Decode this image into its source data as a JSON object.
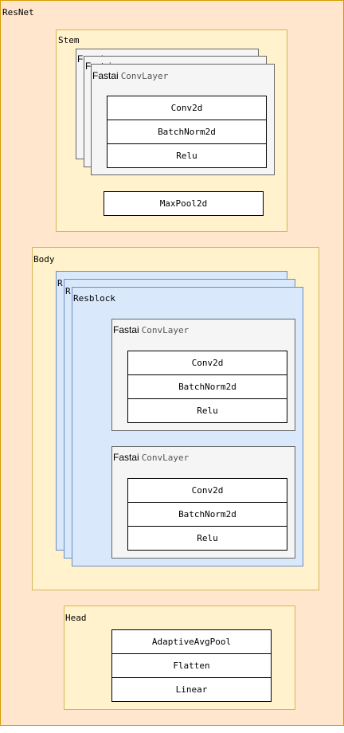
{
  "diagram": {
    "root_label": "ResNet",
    "stem": {
      "label": "Stem",
      "conv_prefix": "Fastai",
      "conv_suffix": "ConvLayer",
      "layers": [
        "Conv2d",
        "BatchNorm2d",
        "Relu"
      ],
      "pool": "MaxPool2d"
    },
    "body": {
      "label": "Body",
      "block_label": "Resblock",
      "back_block_initial": "R",
      "conv1": {
        "prefix": "Fastai",
        "suffix": "ConvLayer",
        "layers": [
          "Conv2d",
          "BatchNorm2d",
          "Relu"
        ]
      },
      "conv2": {
        "prefix": "Fastai",
        "suffix": "ConvLayer",
        "layers": [
          "Conv2d",
          "BatchNorm2d",
          "Relu"
        ]
      }
    },
    "head": {
      "label": "Head",
      "layers": [
        "AdaptiveAvgPool",
        "Flatten",
        "Linear"
      ]
    }
  },
  "colors": {
    "outer_fill": "#ffe6cc",
    "outer_stroke": "#d79b00",
    "section_fill": "#fff2cc",
    "section_stroke": "#d6b656",
    "conv_fill": "#f5f5f5",
    "conv_stroke": "#666666",
    "block_fill": "#dae8fc",
    "block_stroke": "#6c8ebf"
  }
}
